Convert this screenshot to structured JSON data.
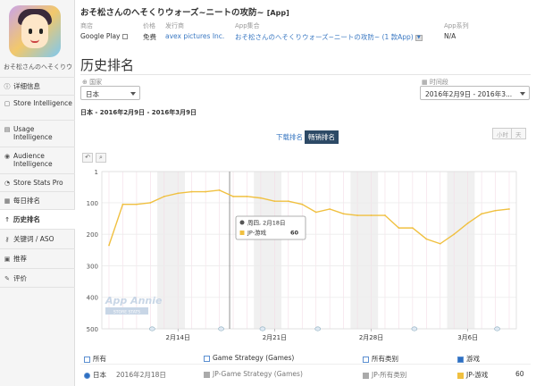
{
  "app": {
    "title": "おそ松さんのへそくりウォーズ~ニートの攻防~",
    "title_tag": "[App]",
    "sidebar_name": "おそ松さんのへそくりウォーズ",
    "store_label": "商店",
    "store_value": "Google Play",
    "price_label": "价格",
    "price_value": "免费",
    "publisher_label": "发行商",
    "publisher_value": "avex pictures Inc.",
    "bundle_label": "App集合",
    "bundle_value": "おそ松さんのへそくりウォーズ~ニートの攻防~ (1 款App)",
    "series_label": "App系列",
    "series_value": "N/A"
  },
  "sidebar": {
    "items": [
      {
        "label": "详细信息",
        "icon": "info-icon"
      },
      {
        "label": "Store Intelligence",
        "icon": "store-icon"
      },
      {
        "label": "Usage Intelligence",
        "icon": "usage-icon"
      },
      {
        "label": "Audience Intelligence",
        "icon": "audience-icon"
      },
      {
        "label": "Store Stats Pro",
        "icon": "stats-icon"
      },
      {
        "label": "每日排名",
        "icon": "calendar-icon"
      },
      {
        "label": "历史排名",
        "icon": "arrow-up-icon"
      },
      {
        "label": "关键词 / ASO",
        "icon": "key-icon"
      },
      {
        "label": "推荐",
        "icon": "recommend-icon"
      },
      {
        "label": "评价",
        "icon": "comment-icon"
      }
    ]
  },
  "page": {
    "title": "历史排名",
    "country_label": "国家",
    "country_value": "日本",
    "period_label": "时间段",
    "period_value": "2016年2月9日 - 2016年3...",
    "date_range": "日本 - 2016年2月9日 - 2016年3月9日",
    "toggle_download": "下载排名",
    "toggle_grossing": "畅销排名",
    "tz_hour": "小时",
    "tz_day": "天"
  },
  "chart_data": {
    "type": "line",
    "y_reversed": true,
    "ylim": [
      1,
      500
    ],
    "yticks": [
      "1",
      "100",
      "200",
      "300",
      "400",
      "500"
    ],
    "xticks": [
      "2月14日",
      "2月21日",
      "2月28日",
      "3月6日"
    ],
    "series": [
      {
        "name": "JP-游戏",
        "color": "#f0c040",
        "x": [
          "2016-02-09",
          "2016-02-10",
          "2016-02-11",
          "2016-02-12",
          "2016-02-13",
          "2016-02-14",
          "2016-02-15",
          "2016-02-16",
          "2016-02-17",
          "2016-02-18",
          "2016-02-19",
          "2016-02-20",
          "2016-02-21",
          "2016-02-22",
          "2016-02-23",
          "2016-02-24",
          "2016-02-25",
          "2016-02-26",
          "2016-02-27",
          "2016-02-28",
          "2016-02-29",
          "2016-03-01",
          "2016-03-02",
          "2016-03-03",
          "2016-03-04",
          "2016-03-05",
          "2016-03-06",
          "2016-03-07",
          "2016-03-08",
          "2016-03-09"
        ],
        "values": [
          235,
          105,
          105,
          100,
          80,
          70,
          65,
          65,
          60,
          80,
          80,
          85,
          95,
          95,
          105,
          130,
          120,
          135,
          140,
          140,
          140,
          180,
          180,
          215,
          230,
          200,
          165,
          135,
          125,
          120
        ]
      }
    ],
    "tooltip": {
      "date": "周四, 2月18日",
      "series": "JP-游戏",
      "value": "60"
    },
    "watermark": "App Annie",
    "watermark_sub": "STORE STATS"
  },
  "legend": {
    "all": "所有",
    "strategy": "Game Strategy (Games)",
    "all_category": "所有类别",
    "games": "游戏",
    "country_row": "日本",
    "date_row": "2016年2月18日",
    "strategy_row": "JP-Game Strategy (Games)",
    "all_category_row": "JP-所有类别",
    "games_row": "JP-游戏",
    "games_value": "60",
    "games_color": "#f0c040",
    "gray_color": "#aaaaaa"
  }
}
